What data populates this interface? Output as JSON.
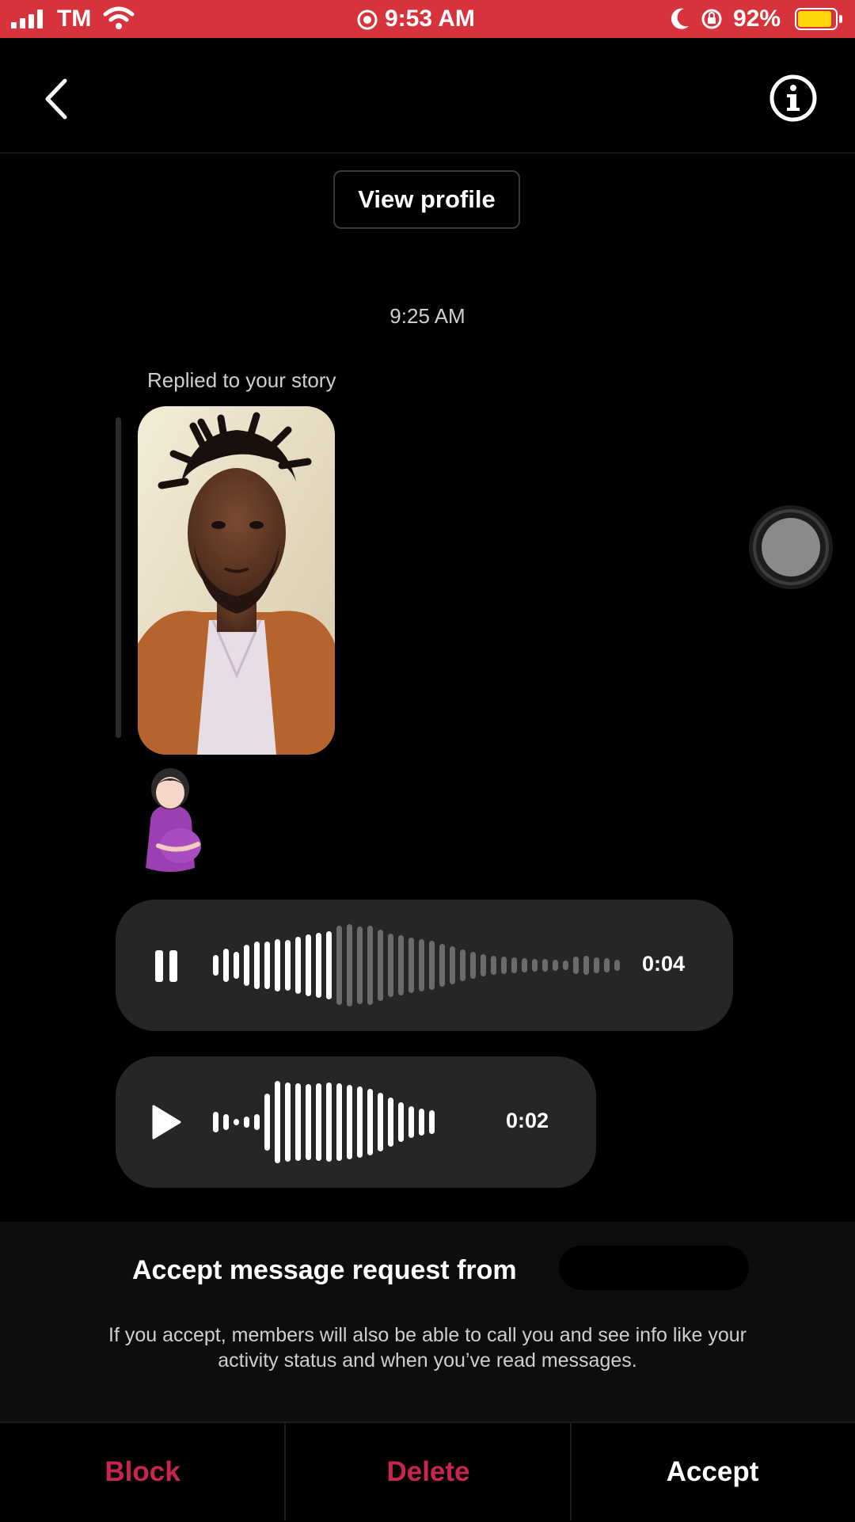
{
  "status_bar": {
    "carrier": "TM",
    "time": "9:53 AM",
    "battery_percent": "92%",
    "battery_level": 0.92,
    "background_color": "#d7333c"
  },
  "header": {
    "back_icon": "chevron-left-icon",
    "info_icon": "info-circle-icon"
  },
  "profile": {
    "view_profile_label": "View profile"
  },
  "conversation": {
    "timestamp": "9:25 AM",
    "story_reply_label": "Replied to your story",
    "emoji": "🤰🏻",
    "voice_messages": [
      {
        "state": "playing",
        "control_icon": "pause-icon",
        "duration": "0:04",
        "progress": 0.3
      },
      {
        "state": "paused",
        "control_icon": "play-icon",
        "duration": "0:02",
        "progress": 0
      }
    ]
  },
  "request": {
    "title": "Accept message request from",
    "description_line1": "If you accept, members will also be able to call you and see info like your",
    "description_line2": "activity status and when you’ve read messages."
  },
  "actions": {
    "block_label": "Block",
    "delete_label": "Delete",
    "accept_label": "Accept",
    "destructive_color": "#c8264f",
    "primary_color": "#ffffff"
  }
}
